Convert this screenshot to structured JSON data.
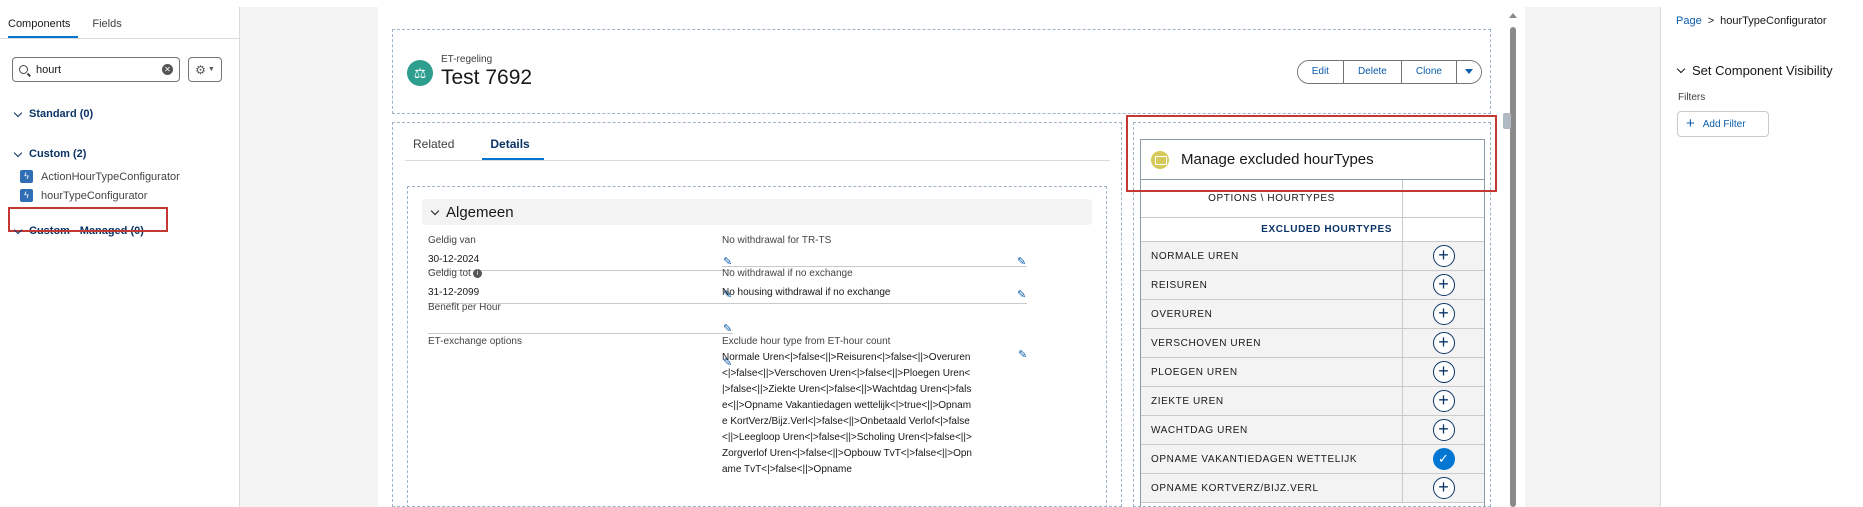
{
  "left_panel": {
    "tabs": [
      {
        "label": "Components"
      },
      {
        "label": "Fields"
      }
    ],
    "search": {
      "value": "hourt"
    },
    "sections": {
      "standard": "Standard (0)",
      "custom": "Custom (2)",
      "managed": "Custom - Managed (0)"
    },
    "custom_items": [
      {
        "label": "ActionHourTypeConfigurator"
      },
      {
        "label": "hourTypeConfigurator"
      }
    ]
  },
  "header": {
    "record_type": "ET-regeling",
    "record_name": "Test 7692",
    "buttons": {
      "edit": "Edit",
      "delete": "Delete",
      "clone": "Clone"
    }
  },
  "details": {
    "tabs": [
      {
        "label": "Related"
      },
      {
        "label": "Details"
      }
    ],
    "section_title": "Algemeen",
    "fields": {
      "geldig_van": {
        "label": "Geldig van",
        "value": "30-12-2024"
      },
      "geldig_tot": {
        "label": "Geldig tot",
        "value": "31-12-2099"
      },
      "benefit": {
        "label": "Benefit per Hour",
        "value": ""
      },
      "et_exchange": {
        "label": "ET-exchange options",
        "value": ""
      },
      "no_withdrawal_trts": {
        "label": "No withdrawal for TR-TS",
        "value": ""
      },
      "no_withdrawal_exchange": {
        "label": "No withdrawal if no exchange",
        "value": "No housing withdrawal if no exchange"
      },
      "exclude_hour": {
        "label": "Exclude hour type from ET-hour count",
        "value": "Normale Uren<|>false<||>Reisuren<|>false<||>Overuren<|>false<||>Verschoven Uren<|>false<||>Ploegen Uren<|>false<||>Ziekte Uren<|>false<||>Wachtdag Uren<|>false<||>Opname Vakantiedagen wettelijk<|>true<||>Opname KortVerz/Bijz.Verl<|>false<||>Onbetaald Verlof<|>false<||>Leegloop Uren<|>false<||>Scholing Uren<|>false<||>Zorgverlof Uren<|>false<||>Opbouw TvT<|>false<||>Opname TvT<|>false<||>Opname"
      }
    }
  },
  "hour_component": {
    "title": "Manage excluded hourTypes",
    "header_col": "OPTIONS \\ HOURTYPES",
    "sub_header": "EXCLUDED HOURTYPES",
    "rows": [
      {
        "label": "NORMALE UREN",
        "checked": false
      },
      {
        "label": "REISUREN",
        "checked": false
      },
      {
        "label": "OVERUREN",
        "checked": false
      },
      {
        "label": "VERSCHOVEN UREN",
        "checked": false
      },
      {
        "label": "PLOEGEN UREN",
        "checked": false
      },
      {
        "label": "ZIEKTE UREN",
        "checked": false
      },
      {
        "label": "WACHTDAG UREN",
        "checked": false
      },
      {
        "label": "OPNAME VAKANTIEDAGEN WETTELIJK",
        "checked": true
      },
      {
        "label": "OPNAME KORTVERZ/BIJZ.VERL",
        "checked": false
      }
    ]
  },
  "right_panel": {
    "breadcrumb": {
      "root": "Page",
      "separator": ">",
      "current": "hourTypeConfigurator"
    },
    "visibility_title": "Set Component Visibility",
    "filters_label": "Filters",
    "add_filter_label": "Add Filter"
  }
}
